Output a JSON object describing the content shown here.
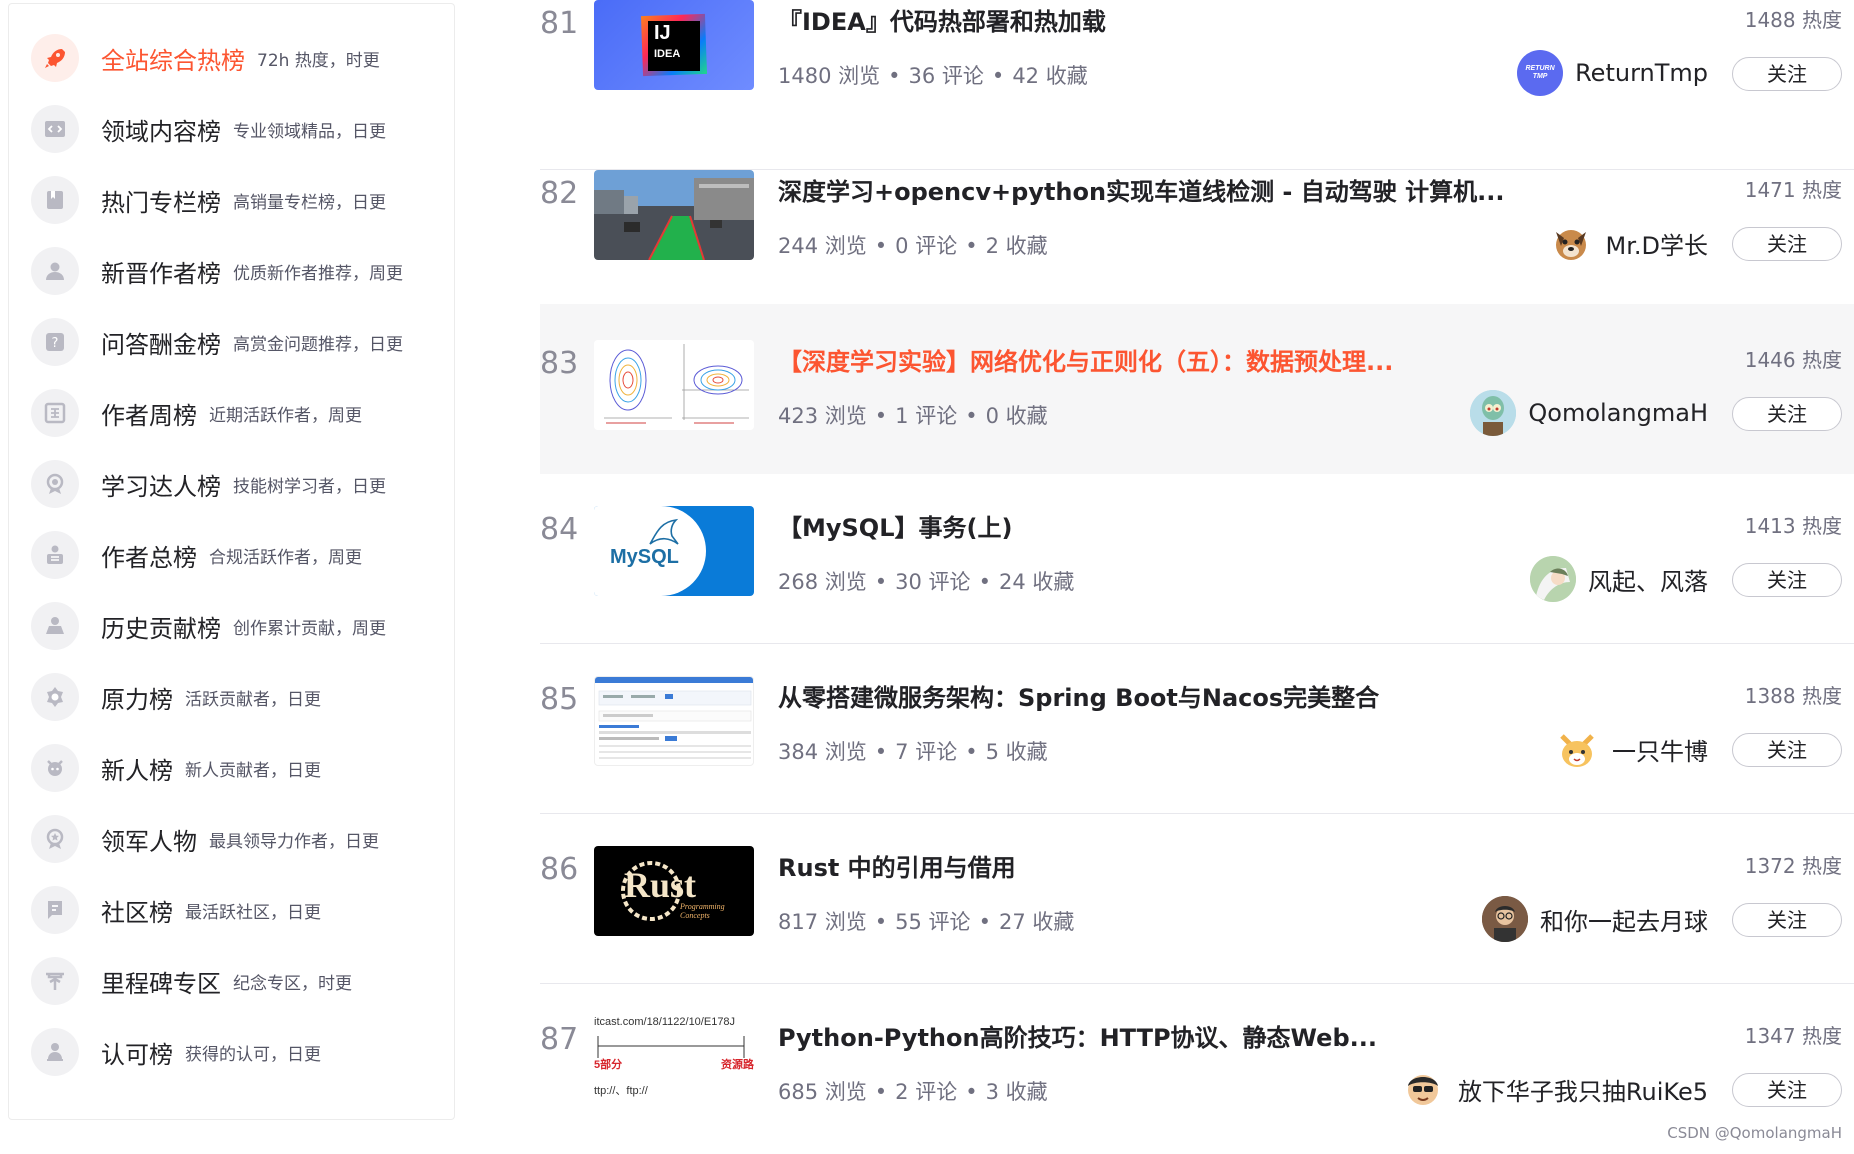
{
  "sidebar": {
    "items": [
      {
        "name": "全站综合热榜",
        "desc": "72h 热度，时更",
        "icon": "rocket-icon"
      },
      {
        "name": "领域内容榜",
        "desc": "专业领域精品，日更",
        "icon": "code-icon"
      },
      {
        "name": "热门专栏榜",
        "desc": "高销量专栏榜，日更",
        "icon": "column-icon"
      },
      {
        "name": "新晋作者榜",
        "desc": "优质新作者推荐，周更",
        "icon": "new-author-icon"
      },
      {
        "name": "问答酬金榜",
        "desc": "高赏金问题推荐，日更",
        "icon": "question-icon"
      },
      {
        "name": "作者周榜",
        "desc": "近期活跃作者，周更",
        "icon": "week-icon"
      },
      {
        "name": "学习达人榜",
        "desc": "技能树学习者，日更",
        "icon": "learner-icon"
      },
      {
        "name": "作者总榜",
        "desc": "合规活跃作者，周更",
        "icon": "author-total-icon"
      },
      {
        "name": "历史贡献榜",
        "desc": "创作累计贡献，周更",
        "icon": "contribution-icon"
      },
      {
        "name": "原力榜",
        "desc": "活跃贡献者，日更",
        "icon": "force-icon"
      },
      {
        "name": "新人榜",
        "desc": "新人贡献者，日更",
        "icon": "newcomer-icon"
      },
      {
        "name": "领军人物",
        "desc": "最具领导力作者，日更",
        "icon": "leader-icon"
      },
      {
        "name": "社区榜",
        "desc": "最活跃社区，日更",
        "icon": "community-icon"
      },
      {
        "name": "里程碑专区",
        "desc": "纪念专区，时更",
        "icon": "milestone-icon"
      },
      {
        "name": "认可榜",
        "desc": "获得的认可，日更",
        "icon": "approval-icon"
      }
    ]
  },
  "list": [
    {
      "rank": "81",
      "title": "『IDEA』代码热部署和热加载",
      "views": "1480 浏览",
      "comments": "36 评论",
      "favs": "42 收藏",
      "heat": "1488 热度",
      "author": "ReturnTmp",
      "follow": "关注",
      "thumb": "idea-logo",
      "avatar": "returntmp-avatar",
      "thumb_text": "IJ",
      "thumb_sub": "IDEA",
      "avatar_text": "RETURN TMP"
    },
    {
      "rank": "82",
      "title": "深度学习+opencv+python实现车道线检测 - 自动驾驶 计算机...",
      "views": "244 浏览",
      "comments": "0 评论",
      "favs": "2 收藏",
      "heat": "1471 热度",
      "author": "Mr.D学长",
      "follow": "关注",
      "thumb": "lane-detection-photo",
      "avatar": "dog-avatar"
    },
    {
      "rank": "83",
      "title": "【深度学习实验】网络优化与正则化（五）：数据预处理...",
      "views": "423 浏览",
      "comments": "1 评论",
      "favs": "0 收藏",
      "heat": "1446 热度",
      "author": "QomolangmaH",
      "follow": "关注",
      "thumb": "contour-plot",
      "avatar": "squidward-avatar",
      "highlight": true
    },
    {
      "rank": "84",
      "title": "【MySQL】事务(上)",
      "views": "268 浏览",
      "comments": "30 评论",
      "favs": "24 收藏",
      "heat": "1413 热度",
      "author": "风起、风落",
      "follow": "关注",
      "thumb": "mysql-logo",
      "avatar": "anime-avatar",
      "thumb_text": "MySQL"
    },
    {
      "rank": "85",
      "title": "从零搭建微服务架构：Spring Boot与Nacos完美整合",
      "views": "384 浏览",
      "comments": "7 评论",
      "favs": "5 收藏",
      "heat": "1388 热度",
      "author": "一只牛博",
      "follow": "关注",
      "thumb": "nacos-console-screenshot",
      "avatar": "cat-avatar"
    },
    {
      "rank": "86",
      "title": "Rust 中的引用与借用",
      "views": "817 浏览",
      "comments": "55 评论",
      "favs": "27 收藏",
      "heat": "1372 热度",
      "author": "和你一起去月球",
      "follow": "关注",
      "thumb": "rust-logo",
      "avatar": "person-avatar",
      "thumb_text": "Rust",
      "thumb_sub": "Programming Concepts"
    },
    {
      "rank": "87",
      "title": "Python-Python高阶技巧：HTTP协议、静态Web...",
      "views": "685 浏览",
      "comments": "2 评论",
      "favs": "3 收藏",
      "heat": "1347 热度",
      "author": "放下华子我只抽RuiKe5",
      "follow": "关注",
      "thumb": "url-diagram",
      "avatar": "cartoon-avatar",
      "thumb_text": "itcast.com/18/1122/10/E178J",
      "thumb_left": "5部分",
      "thumb_right": "资源路",
      "thumb_foot": "ttp://、ftp://"
    }
  ],
  "watermark": "CSDN @QomolangmaH",
  "colors": {
    "accent": "#fc5531",
    "text": "#222226",
    "muted": "#707080",
    "highlight_bg": "#f6f6f7"
  }
}
